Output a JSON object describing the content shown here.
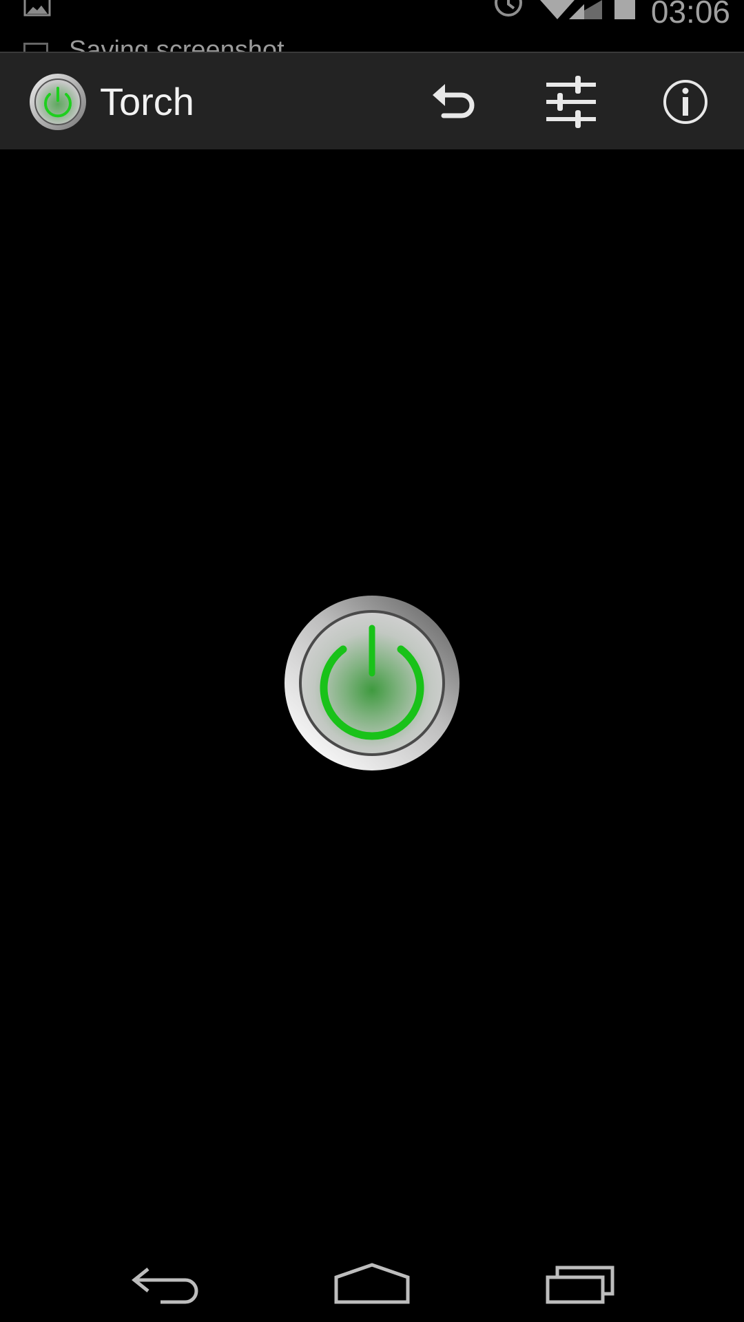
{
  "status_bar": {
    "time": "03:06",
    "notification_ticker": "Saving screenshot...",
    "icons": [
      "gallery-icon",
      "alarm-icon",
      "wifi-icon",
      "signal-icon",
      "battery-icon"
    ]
  },
  "action_bar": {
    "title": "Torch",
    "actions": [
      "undo-icon",
      "sliders-icon",
      "info-icon"
    ]
  },
  "main": {
    "power_button_icon": "power-icon",
    "accent_color": "#22cc22"
  },
  "nav_bar": {
    "buttons": [
      "back-icon",
      "home-icon",
      "recents-icon"
    ]
  }
}
